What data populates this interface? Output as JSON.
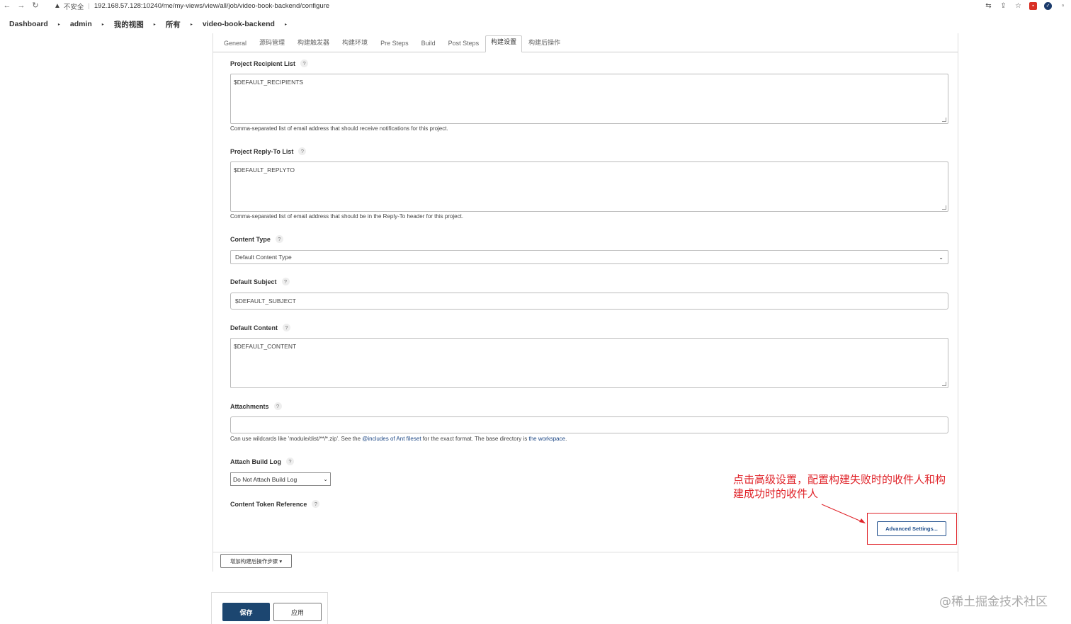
{
  "browser": {
    "back": "←",
    "forward": "→",
    "reload": "↻",
    "warning": "▲",
    "insecure": "不安全",
    "sep": "|",
    "url": "192.168.57.128:10240/me/my-views/view/all/job/video-book-backend/configure",
    "icons": [
      "translate-icon",
      "share-icon",
      "star-icon",
      "extension-icon",
      "profile-icon",
      "window-icon"
    ]
  },
  "breadcrumb": {
    "items": [
      "Dashboard",
      "admin",
      "我的视图",
      "所有",
      "video-book-backend"
    ],
    "sep": "▸"
  },
  "tabs": [
    "General",
    "源码管理",
    "构建触发器",
    "构建环境",
    "Pre Steps",
    "Build",
    "Post Steps",
    "构建设置",
    "构建后操作"
  ],
  "active_tab": "构建设置",
  "help": "?",
  "fields": {
    "recipient_label": "Project Recipient List",
    "recipient_value": "$DEFAULT_RECIPIENTS",
    "recipient_desc": "Comma-separated list of email address that should receive notifications for this project.",
    "replyto_label": "Project Reply-To List",
    "replyto_value": "$DEFAULT_REPLYTO",
    "replyto_desc": "Comma-separated list of email address that should be in the Reply-To header for this project.",
    "content_type_label": "Content Type",
    "content_type_value": "Default Content Type",
    "subject_label": "Default Subject",
    "subject_value": "$DEFAULT_SUBJECT",
    "content_label": "Default Content",
    "content_value": "$DEFAULT_CONTENT",
    "attachments_label": "Attachments",
    "attachments_value": "",
    "attachments_desc_1": "Can use wildcards like 'module/dist/**/*.zip'. See the ",
    "attachments_link_1": "@includes of Ant fileset",
    "attachments_desc_2": " for the exact format. The base directory is ",
    "attachments_link_2": "the workspace",
    "attachments_desc_3": ".",
    "build_log_label": "Attach Build Log",
    "build_log_value": "Do Not Attach Build Log",
    "token_label": "Content Token Reference",
    "advanced_button": "Advanced Settings..."
  },
  "annotation": {
    "text": "点击高级设置，配置构建失败时的收件人和构建成功时的收件人",
    "color": "#e0242a"
  },
  "add_step_button": "增加构建后操作步骤 ▾",
  "footer": {
    "save": "保存",
    "apply": "应用"
  },
  "watermark": "@稀土掘金技术社区"
}
